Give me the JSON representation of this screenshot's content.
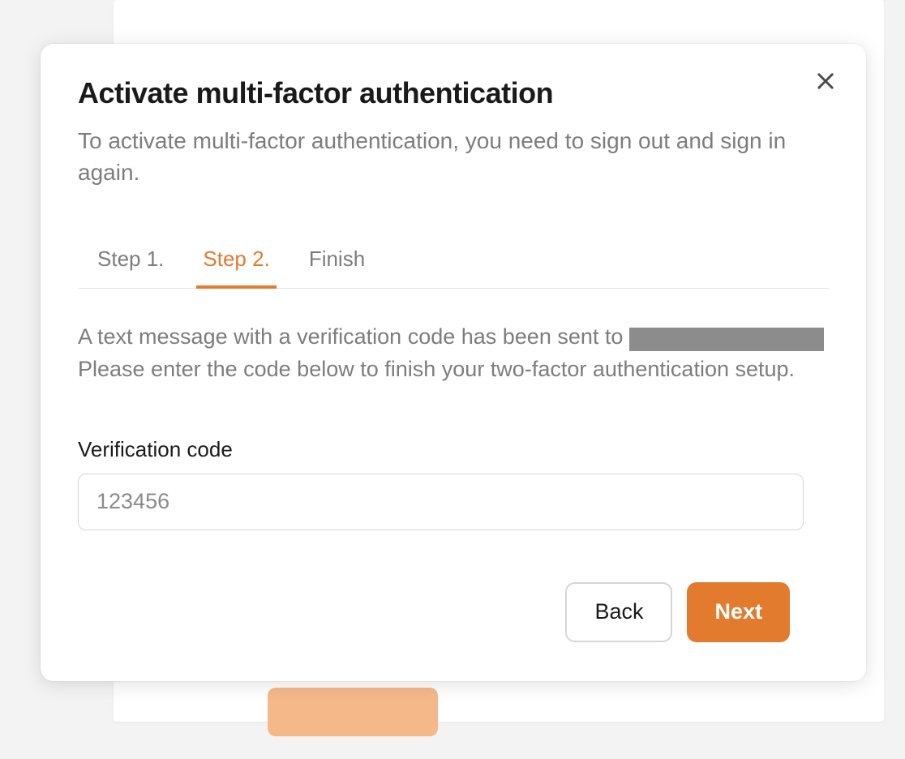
{
  "modal": {
    "title": "Activate multi-factor authentication",
    "subtitle": "To activate multi-factor authentication, you need to sign out and sign in again.",
    "tabs": [
      {
        "label": "Step 1.",
        "active": false
      },
      {
        "label": "Step 2.",
        "active": true
      },
      {
        "label": "Finish",
        "active": false
      }
    ],
    "body_text_before": "A text message with a verification code has been sent to ",
    "body_text_after": "Please enter the code below to finish your two-factor authentication setup.",
    "field": {
      "label": "Verification code",
      "placeholder": "123456",
      "value": ""
    },
    "buttons": {
      "back": "Back",
      "next": "Next"
    }
  },
  "colors": {
    "accent": "#e37b2f"
  }
}
